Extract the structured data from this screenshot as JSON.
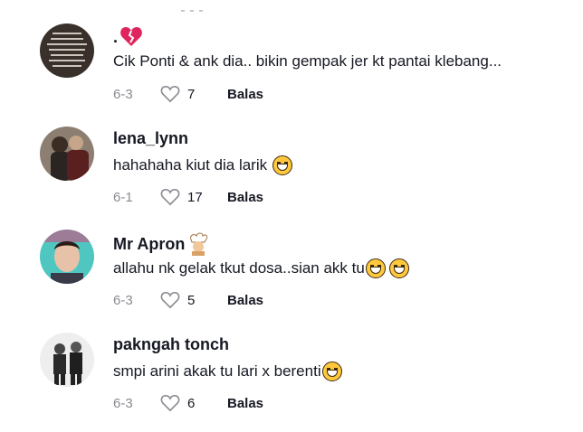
{
  "comments": [
    {
      "author": ".",
      "text": "Cik Ponti & ank dia.. bikin gempak jer kt pantai klebang...",
      "date": "6-3",
      "likes": "7",
      "reply": "Balas",
      "avatar_icon": "text-collage-avatar",
      "author_badge": "broken-heart-icon"
    },
    {
      "author": "lena_lynn",
      "text": "hahahaha kiut dia larik",
      "date": "6-1",
      "likes": "17",
      "reply": "Balas",
      "emoji": "laughing-emoji"
    },
    {
      "author": "Mr Apron",
      "text": "allahu nk gelak tkut dosa..sian akk tu",
      "date": "6-3",
      "likes": "5",
      "reply": "Balas",
      "author_badge": "chef-emoji",
      "emoji": "sweat-smile-emoji"
    },
    {
      "author": "pakngah tonch",
      "text": "smpi arini akak tu lari x berenti",
      "date": "6-3",
      "likes": "6",
      "reply": "Balas",
      "emoji": "laughing-emoji"
    }
  ],
  "colors": {
    "text": "#161823",
    "muted": "#8a8b91",
    "heart": "#d2d3d6"
  }
}
